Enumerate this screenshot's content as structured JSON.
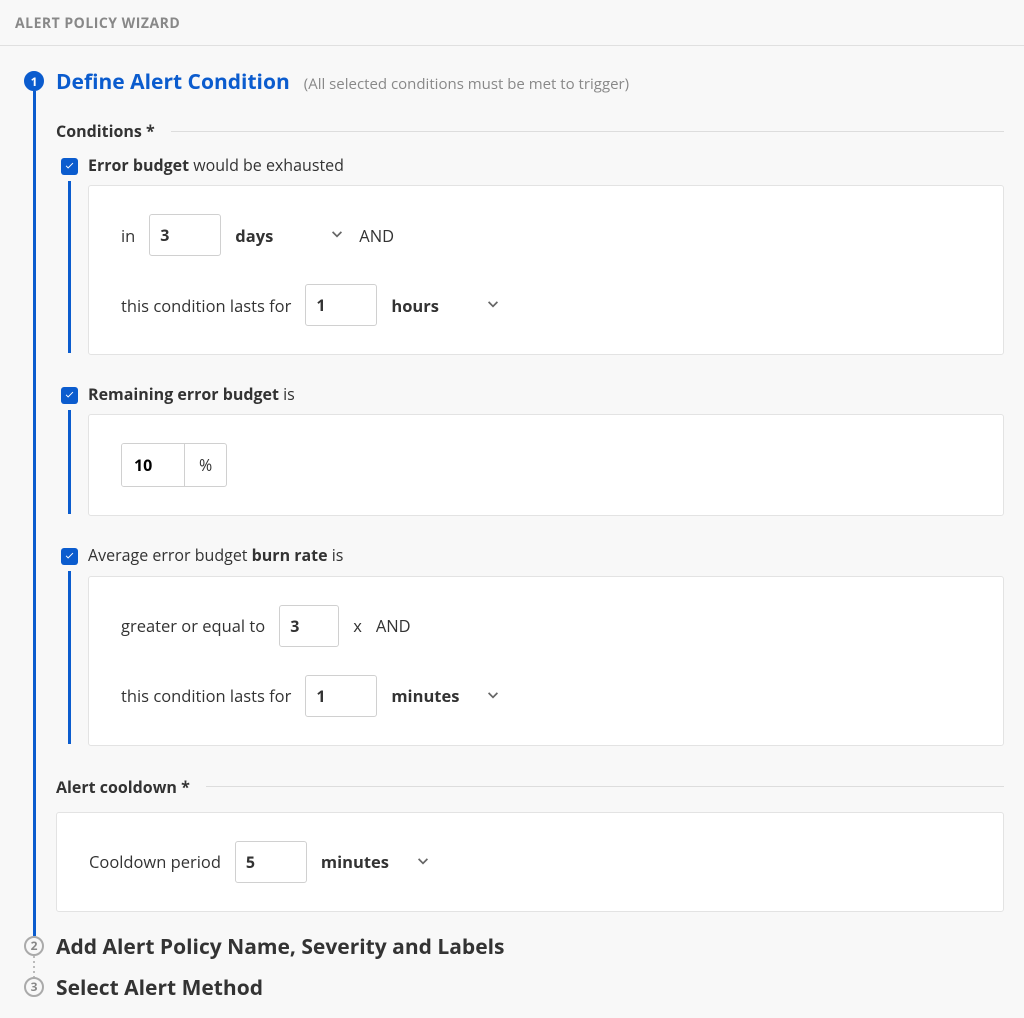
{
  "header": {
    "title": "ALERT POLICY WIZARD"
  },
  "steps": [
    {
      "num": "1",
      "title": "Define Alert Condition",
      "subtitle": "(All selected conditions must be met to trigger)"
    },
    {
      "num": "2",
      "title": "Add Alert Policy Name, Severity and Labels"
    },
    {
      "num": "3",
      "title": "Select Alert Method"
    }
  ],
  "sections": {
    "conditions_label": "Conditions *",
    "cooldown_label": "Alert cooldown *"
  },
  "conditions": {
    "error_budget": {
      "checked": true,
      "label_bold": "Error budget",
      "label_rest": "would be exhausted",
      "in_text": "in",
      "in_value": "3",
      "in_unit": "days",
      "and_text": "AND",
      "lasts_text": "this condition lasts for",
      "lasts_value": "1",
      "lasts_unit": "hours"
    },
    "remaining": {
      "checked": true,
      "label_bold": "Remaining error budget",
      "label_rest": "is",
      "value": "10",
      "suffix": "%"
    },
    "burn_rate": {
      "checked": true,
      "label_pre": "Average error budget ",
      "label_bold": "burn rate",
      "label_rest": " is",
      "gte_text": "greater or equal to",
      "gte_value": "3",
      "x_text": "x",
      "and_text": "AND",
      "lasts_text": "this condition lasts for",
      "lasts_value": "1",
      "lasts_unit": "minutes"
    }
  },
  "cooldown": {
    "label": "Cooldown period",
    "value": "5",
    "unit": "minutes"
  }
}
